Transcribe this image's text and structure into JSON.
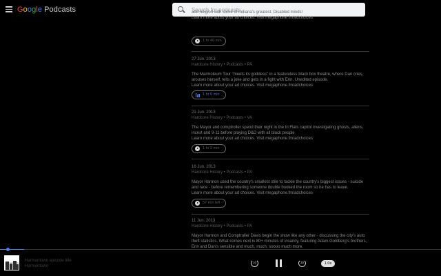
{
  "header": {
    "logo_google": [
      "G",
      "o",
      "o",
      "g",
      "l",
      "e"
    ],
    "logo_product": "Podcasts",
    "search_placeholder": "Search for podcasts"
  },
  "episodes": [
    {
      "date": "",
      "podcast": "",
      "desc": "add religion with some of Indiana's greatest. Disabled minds!",
      "desc2": "Learn more about your ad choices.  Visit megaphone.fm/adchoices",
      "duration": "1 hr 40 min",
      "state": "idle"
    },
    {
      "date": "27 Jun. 2013",
      "podcast": "Hardcore History • Podcasts • PA",
      "desc": "The Marmoleum Tour \"meets its goddess\" in a featureless black box theatre, where Dan cries, arouses herself, tells a joke and gets in a fight with Erin. Unedited episode.",
      "desc2": "Learn more about your ad choices.  Visit megaphone.fm/adchoices",
      "duration": "1 hr 0 min",
      "state": "playing"
    },
    {
      "date": "21 Jun. 2013",
      "podcast": "Hardcore History • Podcasts • VA",
      "desc": "The Mayor and comptroller spend their night in the tri Flats capitol investigating ghosts, aliens, incest and 9-11 before playing D&D with all black people",
      "desc2": "Learn more about your ad choices.  Visit megaphone.fm/adchoices",
      "duration": "1 hr 2 min",
      "state": "idle"
    },
    {
      "date": "16 Jun. 2013",
      "podcast": "Hardcore History • Podcasts • PA",
      "desc": "Mayor Harmon used the country's smallest stile to tackle the country's biggest issues - suicide and race - before remembering someone double booked the room so he has to leave.",
      "desc2": "Learn more about your ad choices.  Visit megaphone.fm/adchoices",
      "duration": "57 min left",
      "state": "idle"
    },
    {
      "date": "11 Jun. 2013",
      "podcast": "Hardcore History • Podcasts • PA",
      "desc": "Mayor Harmon and Comptroller Davis begin the show like any other - discussing the city's auto theft statistics. What comes next is 80+ minutes of insanity, featuring Adam Goldberg's brothers, Erin and Dan's sensible and much, much, soooo much more.",
      "desc2": "",
      "duration": "",
      "state": "idle"
    }
  ],
  "player": {
    "title": "Harmontown episode title",
    "podcast": "Harmontown",
    "rewind_label": "10",
    "forward_label": "30",
    "speed_label": "1.0x",
    "progress_fraction": 0.055
  },
  "colors": {
    "accent": "#4d7ee8",
    "background": "#000000"
  }
}
